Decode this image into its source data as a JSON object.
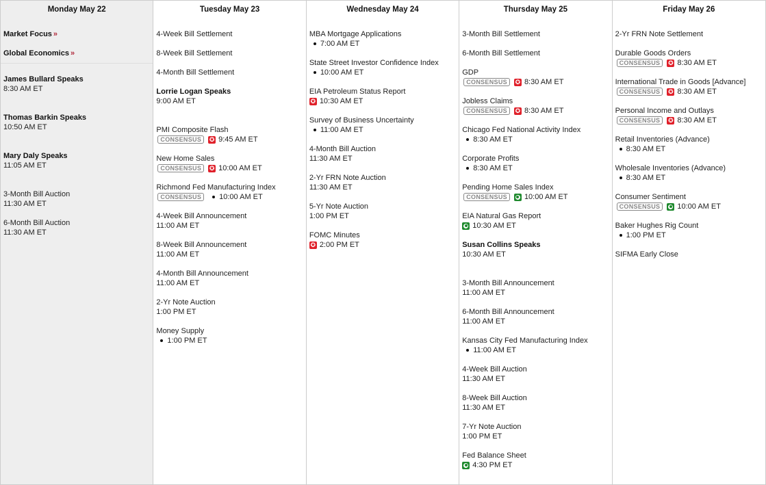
{
  "colors": {
    "star_icon": "#e0202a",
    "green_icon": "#1f8a2e",
    "link_arrow": "#b0283a",
    "monday_bg": "#eeeeee"
  },
  "days": [
    {
      "label": "Monday May 22",
      "links": [
        {
          "label": "Market Focus",
          "arrow": "»"
        },
        {
          "label": "Global Economics",
          "arrow": "»"
        }
      ],
      "items": [
        {
          "title": "James Bullard Speaks",
          "time": "8:30 AM ET",
          "speaker": true
        },
        {
          "title": "Thomas Barkin Speaks",
          "time": "10:50 AM ET",
          "speaker": true
        },
        {
          "title": "Mary Daly Speaks",
          "time": "11:05 AM ET",
          "speaker": true
        },
        {
          "title": "3-Month Bill Auction",
          "time": "11:30 AM ET"
        },
        {
          "title": "6-Month Bill Auction",
          "time": "11:30 AM ET"
        }
      ]
    },
    {
      "label": "Tuesday May 23",
      "items": [
        {
          "title": "4-Week Bill Settlement"
        },
        {
          "title": "8-Week Bill Settlement"
        },
        {
          "title": "4-Month Bill Settlement"
        },
        {
          "title": "Lorrie Logan Speaks",
          "time": "9:00 AM ET",
          "speaker": true
        },
        {
          "title": "PMI Composite Flash",
          "consensus": "CONSENSUS",
          "icon": "star",
          "time": "9:45 AM ET"
        },
        {
          "title": "New Home Sales",
          "consensus": "CONSENSUS",
          "icon": "star",
          "time": "10:00 AM ET"
        },
        {
          "title": "Richmond Fed Manufacturing Index",
          "consensus": "CONSENSUS",
          "icon": "dot",
          "time": "10:00 AM ET"
        },
        {
          "title": "4-Week Bill Announcement",
          "time": "11:00 AM ET"
        },
        {
          "title": "8-Week Bill Announcement",
          "time": "11:00 AM ET"
        },
        {
          "title": "4-Month Bill Announcement",
          "time": "11:00 AM ET"
        },
        {
          "title": "2-Yr Note Auction",
          "time": "1:00 PM ET"
        },
        {
          "title": "Money Supply",
          "icon": "dot",
          "time": "1:00 PM ET"
        }
      ]
    },
    {
      "label": "Wednesday May 24",
      "items": [
        {
          "title": "MBA Mortgage Applications",
          "icon": "dot",
          "time": "7:00 AM ET"
        },
        {
          "title": "State Street Investor Confidence Index",
          "time": "10:00 AM ET",
          "icon": "dot"
        },
        {
          "title": "EIA Petroleum Status Report",
          "icon": "star",
          "time": "10:30 AM ET"
        },
        {
          "title": "Survey of Business Uncertainty",
          "icon": "dot",
          "time": "11:00 AM ET"
        },
        {
          "title": "4-Month Bill Auction",
          "time": "11:30 AM ET"
        },
        {
          "title": "2-Yr FRN Note Auction",
          "time": "11:30 AM ET"
        },
        {
          "title": "5-Yr Note Auction",
          "time": "1:00 PM ET"
        },
        {
          "title": "FOMC Minutes",
          "icon": "star",
          "time": "2:00 PM ET"
        }
      ]
    },
    {
      "label": "Thursday May 25",
      "items": [
        {
          "title": "3-Month Bill Settlement"
        },
        {
          "title": "6-Month Bill Settlement"
        },
        {
          "title": "GDP",
          "consensus": "CONSENSUS",
          "icon": "star",
          "time": "8:30 AM ET"
        },
        {
          "title": "Jobless Claims",
          "consensus": "CONSENSUS",
          "icon": "star",
          "time": "8:30 AM ET"
        },
        {
          "title": "Chicago Fed National Activity Index",
          "icon": "dot",
          "time": "8:30 AM ET"
        },
        {
          "title": "Corporate Profits",
          "icon": "dot",
          "time": "8:30 AM ET"
        },
        {
          "title": "Pending Home Sales Index",
          "consensus": "CONSENSUS",
          "icon": "green",
          "time": "10:00 AM ET"
        },
        {
          "title": "EIA Natural Gas Report",
          "icon": "green",
          "time": "10:30 AM ET"
        },
        {
          "title": "Susan Collins Speaks",
          "time": "10:30 AM ET",
          "speaker": true
        },
        {
          "title": "3-Month Bill Announcement",
          "time": "11:00 AM ET"
        },
        {
          "title": "6-Month Bill Announcement",
          "time": "11:00 AM ET"
        },
        {
          "title": "Kansas City Fed Manufacturing Index",
          "icon": "dot",
          "time": "11:00 AM ET"
        },
        {
          "title": "4-Week Bill Auction",
          "time": "11:30 AM ET"
        },
        {
          "title": "8-Week Bill Auction",
          "time": "11:30 AM ET"
        },
        {
          "title": "7-Yr Note Auction",
          "time": "1:00 PM ET"
        },
        {
          "title": "Fed Balance Sheet",
          "icon": "green",
          "time": "4:30 PM ET"
        }
      ]
    },
    {
      "label": "Friday May 26",
      "items": [
        {
          "title": "2-Yr FRN Note Settlement"
        },
        {
          "title": "Durable Goods Orders",
          "consensus": "CONSENSUS",
          "icon": "star",
          "time": "8:30 AM ET"
        },
        {
          "title": "International Trade in Goods [Advance]",
          "consensus": "CONSENSUS",
          "icon": "star",
          "time": "8:30 AM ET"
        },
        {
          "title": "Personal Income and Outlays",
          "consensus": "CONSENSUS",
          "icon": "star",
          "time": "8:30 AM ET"
        },
        {
          "title": "Retail Inventories (Advance)",
          "icon": "dot",
          "time": "8:30 AM ET"
        },
        {
          "title": "Wholesale Inventories (Advance)",
          "icon": "dot",
          "time": "8:30 AM ET"
        },
        {
          "title": "Consumer Sentiment",
          "consensus": "CONSENSUS",
          "icon": "green",
          "time": "10:00 AM ET"
        },
        {
          "title": "Baker Hughes Rig Count",
          "icon": "dot",
          "time": "1:00 PM ET"
        },
        {
          "title": "SIFMA Early Close"
        }
      ]
    }
  ]
}
